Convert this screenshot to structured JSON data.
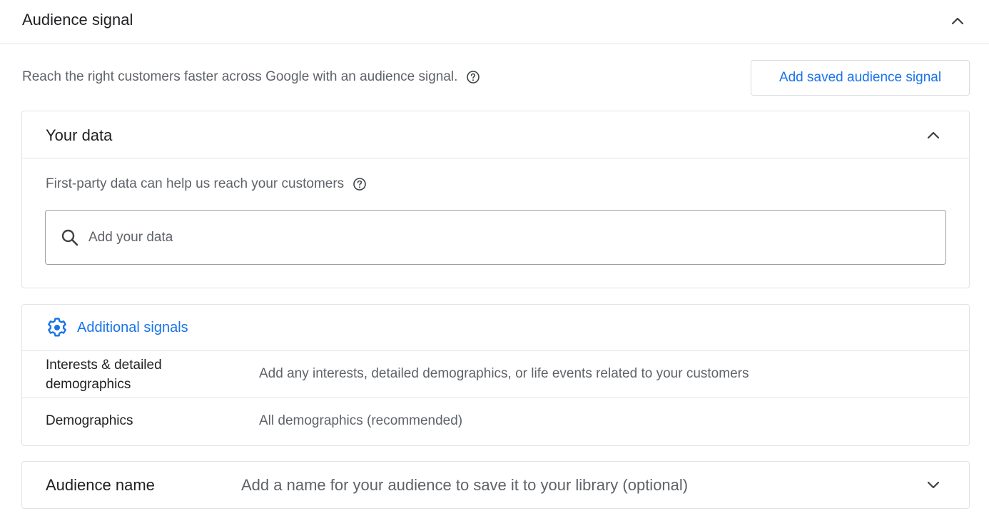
{
  "section": {
    "title": "Audience signal",
    "toggle_icon": "chevron-up-icon",
    "description": "Reach the right customers faster across Google with an audience signal.",
    "help_icon": "help-circle-icon",
    "saved_button_label": "Add saved audience signal"
  },
  "your_data": {
    "title": "Your data",
    "toggle_icon": "chevron-up-icon",
    "description": "First-party data can help us reach your customers",
    "help_icon": "help-circle-icon",
    "search": {
      "icon": "search-icon",
      "placeholder": "Add your data",
      "value": ""
    }
  },
  "additional_signals": {
    "link_label": "Additional signals",
    "link_icon": "gear-icon",
    "rows": [
      {
        "label": "Interests & detailed demographics",
        "value": "Add any interests, detailed demographics, or life events related to your customers"
      },
      {
        "label": "Demographics",
        "value": "All demographics (recommended)"
      }
    ]
  },
  "audience_name": {
    "label": "Audience name",
    "placeholder": "Add a name for your audience to save it to your library (optional)",
    "toggle_icon": "chevron-down-icon"
  },
  "colors": {
    "accent": "#1a73e8",
    "primary_text": "#202124",
    "secondary_text": "#5f6368",
    "border": "#e3e3e3"
  }
}
